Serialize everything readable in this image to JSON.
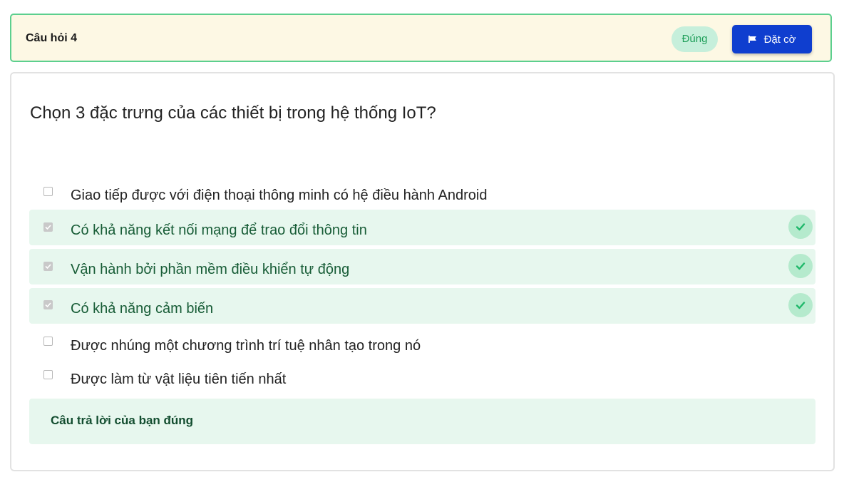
{
  "header": {
    "title": "Câu hỏi 4",
    "status": "Đúng",
    "flag_label": "Đặt cờ"
  },
  "question": {
    "text": "Chọn 3 đặc trưng của các thiết bị trong hệ thống IoT?"
  },
  "answers": [
    {
      "label": "Giao tiếp được với điện thoại thông minh có hệ điều hành Android",
      "checked": false,
      "correct": false
    },
    {
      "label": "Có khả năng kết nối mạng để trao đổi thông tin",
      "checked": true,
      "correct": true
    },
    {
      "label": "Vận hành bởi phần mềm điều khiển tự động",
      "checked": true,
      "correct": true
    },
    {
      "label": "Có khả năng cảm biến",
      "checked": true,
      "correct": true
    },
    {
      "label": "Được nhúng một chương trình trí tuệ nhân tạo trong nó",
      "checked": false,
      "correct": false
    },
    {
      "label": "Được làm từ vật liệu tiên tiến nhất",
      "checked": false,
      "correct": false
    }
  ],
  "feedback": {
    "text": "Câu trả lời của bạn đúng"
  },
  "colors": {
    "accent": "#0f3ecf",
    "correct_bg": "#e7f7ee",
    "correct_icon": "#1fb86a",
    "header_bg": "#fdf8e4",
    "header_border": "#5ccf8e"
  },
  "icons": {
    "flag": "flag-icon",
    "correct": "check-circle-icon"
  }
}
